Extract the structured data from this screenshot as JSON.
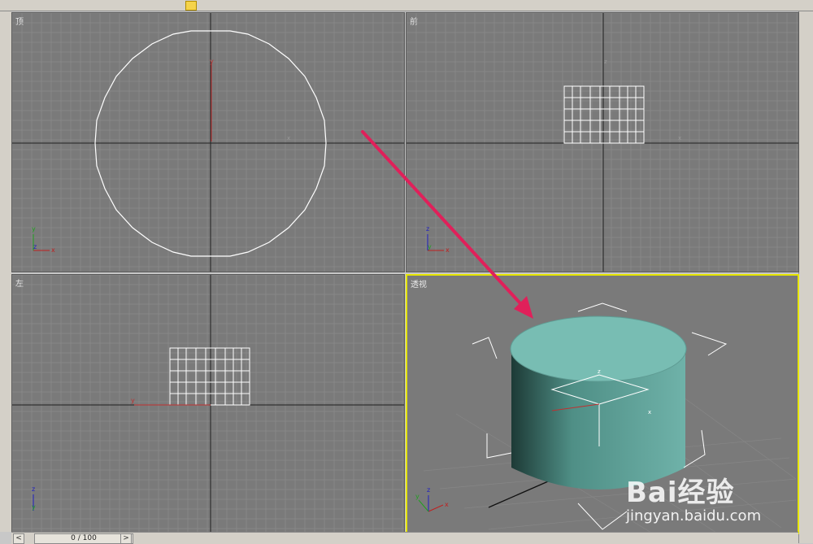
{
  "viewports": {
    "top": {
      "label": "顶"
    },
    "front": {
      "label": "前"
    },
    "left": {
      "label": "左"
    },
    "perspective": {
      "label": "透视"
    }
  },
  "axes": {
    "x": "x",
    "y": "y",
    "z": "z"
  },
  "timeline": {
    "frame": "0 / 100",
    "prev": "<",
    "next": ">"
  },
  "watermark": {
    "logo": "Bai经验",
    "url": "jingyan.baidu.com"
  },
  "colors": {
    "viewport_bg": "#7a7a7a",
    "grid": "#8f8f8f",
    "cylinder": "#6fb2a9",
    "active_border": "#e6e600",
    "arrow": "#e0205a"
  }
}
